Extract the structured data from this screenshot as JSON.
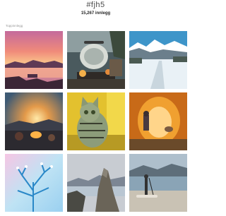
{
  "header": {
    "hashtag": "#fjh5",
    "post_count": "15,267 innlegg"
  },
  "section": {
    "label": "Toppinnlegg"
  },
  "grid": {
    "tiles": [
      {
        "subject": "sunset-lake"
      },
      {
        "subject": "camping-kettle"
      },
      {
        "subject": "snowy-mountain-road"
      },
      {
        "subject": "campfire-sunset"
      },
      {
        "subject": "tabby-cat"
      },
      {
        "subject": "orange-tent"
      },
      {
        "subject": "frosted-tree"
      },
      {
        "subject": "coastal-mountains"
      },
      {
        "subject": "beach-paddleboard"
      }
    ]
  }
}
